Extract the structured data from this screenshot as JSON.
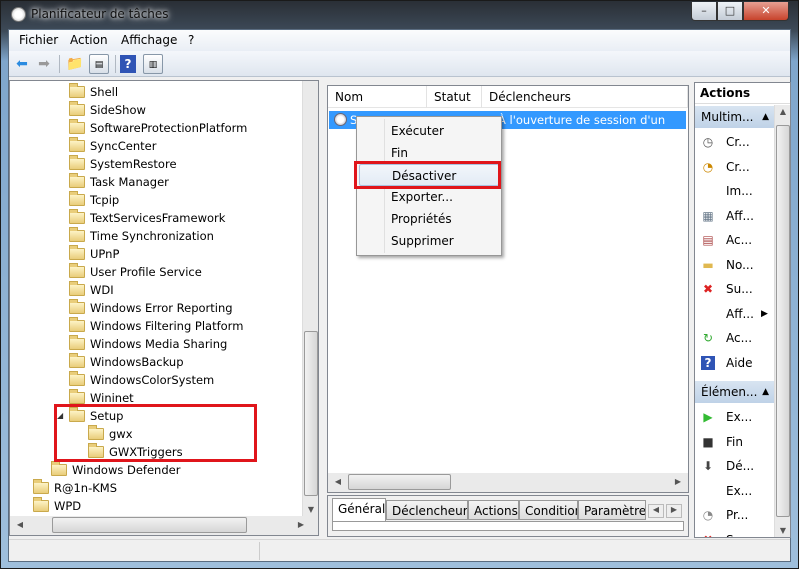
{
  "window": {
    "title": "Planificateur de tâches",
    "minimize": "–",
    "maximize": "□",
    "close": "✕"
  },
  "menu": [
    "Fichier",
    "Action",
    "Affichage",
    "?"
  ],
  "toolbar": {
    "back": "back-icon",
    "forward": "forward-icon",
    "up": "folder-up-icon",
    "show_hide_tree": "console-tree-icon",
    "help": "help-icon",
    "show_hide_actions": "action-pane-icon"
  },
  "tree": [
    {
      "label": "Shell",
      "level": 2
    },
    {
      "label": "SideShow",
      "level": 2
    },
    {
      "label": "SoftwareProtectionPlatform",
      "level": 2
    },
    {
      "label": "SyncCenter",
      "level": 2
    },
    {
      "label": "SystemRestore",
      "level": 2
    },
    {
      "label": "Task Manager",
      "level": 2
    },
    {
      "label": "Tcpip",
      "level": 2
    },
    {
      "label": "TextServicesFramework",
      "level": 2
    },
    {
      "label": "Time Synchronization",
      "level": 2
    },
    {
      "label": "UPnP",
      "level": 2
    },
    {
      "label": "User Profile Service",
      "level": 2
    },
    {
      "label": "WDI",
      "level": 2
    },
    {
      "label": "Windows Error Reporting",
      "level": 2
    },
    {
      "label": "Windows Filtering Platform",
      "level": 2
    },
    {
      "label": "Windows Media Sharing",
      "level": 2
    },
    {
      "label": "WindowsBackup",
      "level": 2
    },
    {
      "label": "WindowsColorSystem",
      "level": 2
    },
    {
      "label": "Wininet",
      "level": 2
    },
    {
      "label": "Setup",
      "level": 2,
      "expanded": true
    },
    {
      "label": "gwx",
      "level": 3
    },
    {
      "label": "GWXTriggers",
      "level": 3
    },
    {
      "label": "Windows Defender",
      "level": 1
    },
    {
      "label": "R@1n-KMS",
      "level": 0
    },
    {
      "label": "WPD",
      "level": 0
    }
  ],
  "task_list": {
    "columns": [
      "Nom",
      "Statut",
      "Déclencheurs"
    ],
    "selected_row": {
      "name": "S",
      "trigger": "À l'ouverture de session d'un utilisat"
    }
  },
  "context_menu": {
    "items": [
      "Exécuter",
      "Fin",
      "Désactiver",
      "Exporter...",
      "Propriétés",
      "Supprimer"
    ],
    "highlighted": "Désactiver"
  },
  "detail_tabs": [
    "Général",
    "Déclencheurs",
    "Actions",
    "Conditions",
    "Paramètre"
  ],
  "actions": {
    "title": "Actions",
    "section1": {
      "title": "Multim...",
      "items": [
        {
          "icon": "create-basic-task-icon",
          "label": "Cr..."
        },
        {
          "icon": "create-task-icon",
          "label": "Cr..."
        },
        {
          "icon": "",
          "label": "Im..."
        },
        {
          "icon": "display-running-tasks-icon",
          "label": "Aff..."
        },
        {
          "icon": "enable-history-icon",
          "label": "Ac..."
        },
        {
          "icon": "new-folder-icon",
          "label": "No..."
        },
        {
          "icon": "delete-icon",
          "label": "Su..."
        },
        {
          "icon": "",
          "label": "Aff...",
          "submenu": true
        },
        {
          "icon": "refresh-icon",
          "label": "Ac..."
        },
        {
          "icon": "help-icon",
          "label": "Aide"
        }
      ]
    },
    "section2": {
      "title": "Élémen...",
      "items": [
        {
          "icon": "run-icon",
          "label": "Ex..."
        },
        {
          "icon": "stop-icon",
          "label": "Fin"
        },
        {
          "icon": "disable-icon",
          "label": "Dé..."
        },
        {
          "icon": "",
          "label": "Ex..."
        },
        {
          "icon": "properties-icon",
          "label": "Pr..."
        },
        {
          "icon": "delete-icon",
          "label": "Su..."
        }
      ]
    }
  },
  "colors": {
    "highlight_box": "#e0151b",
    "selection": "#3399ff",
    "section_header": "#c9d9ec"
  }
}
